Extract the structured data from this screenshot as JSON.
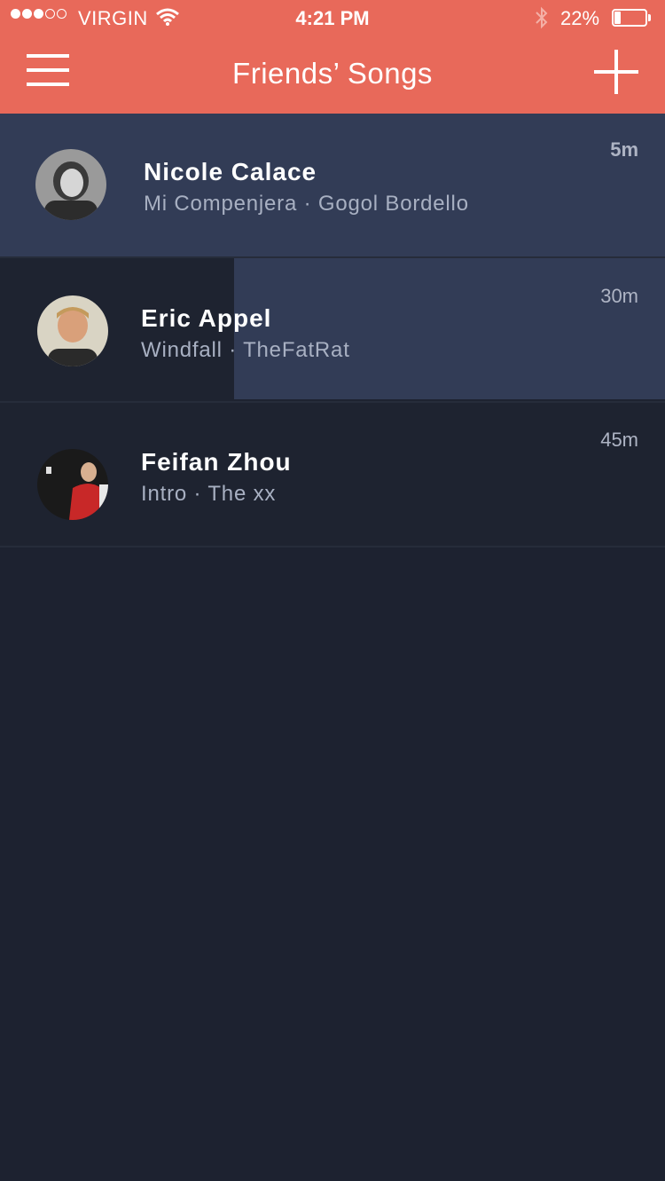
{
  "status_bar": {
    "carrier": "VIRGIN",
    "time": "4:21 PM",
    "battery": "22%",
    "battery_level": 0.22,
    "signal_strength": 3,
    "signal_max": 5
  },
  "header": {
    "title": "Friends’ Songs",
    "menu_icon": "hamburger-menu-icon",
    "add_icon": "plus-icon",
    "color": "#e8695a"
  },
  "friends": [
    {
      "name": "Nicole Calace",
      "song": "Mi Compenjera",
      "artist": "Gogol Bordello",
      "separator": "·",
      "age": "5m"
    },
    {
      "name": "Eric Appel",
      "song": "Windfall",
      "artist": "TheFatRat",
      "separator": "·",
      "age": "30m"
    },
    {
      "name": "Feifan Zhou",
      "song": "Intro",
      "artist": "The xx",
      "separator": "·",
      "age": "45m"
    }
  ],
  "colors": {
    "background": "#1d2230",
    "row_highlight": "#323c56",
    "secondary_text": "#a8b0c2"
  }
}
